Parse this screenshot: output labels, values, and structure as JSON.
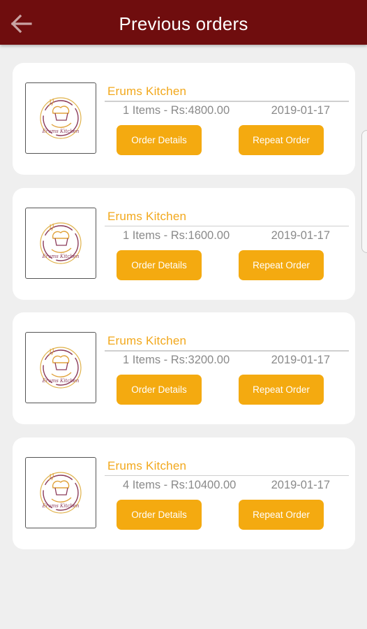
{
  "header": {
    "title": "Previous orders",
    "back_icon": "arrow-left-icon",
    "background": "#6f0d0e"
  },
  "colors": {
    "accent": "#f4aa10",
    "kitchen_name": "#f2a81c",
    "page_background": "#efefef"
  },
  "orders": [
    {
      "kitchen": "Erums Kitchen",
      "summary": "1 Items - Rs:4800.00",
      "date": "2019-01-17",
      "details_label": "Order Details",
      "repeat_label": "Repeat Order",
      "logo_icon": "chef-logo-icon",
      "logo_text": "Erums Kitchen"
    },
    {
      "kitchen": "Erums Kitchen",
      "summary": "1 Items - Rs:1600.00",
      "date": "2019-01-17",
      "details_label": "Order Details",
      "repeat_label": "Repeat Order",
      "logo_icon": "chef-logo-icon",
      "logo_text": "Erums Kitchen"
    },
    {
      "kitchen": "Erums Kitchen",
      "summary": "1 Items - Rs:3200.00",
      "date": "2019-01-17",
      "details_label": "Order Details",
      "repeat_label": "Repeat Order",
      "logo_icon": "chef-logo-icon",
      "logo_text": "Erums Kitchen"
    },
    {
      "kitchen": "Erums Kitchen",
      "summary": "4 Items - Rs:10400.00",
      "date": "2019-01-17",
      "details_label": "Order Details",
      "repeat_label": "Repeat Order",
      "logo_icon": "chef-logo-icon",
      "logo_text": "Erums Kitchen"
    }
  ]
}
